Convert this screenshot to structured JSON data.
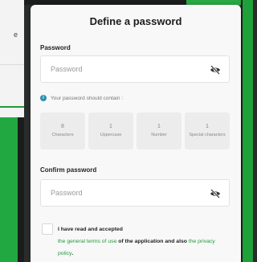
{
  "background": {
    "left_partial_text": "e"
  },
  "modal": {
    "title": "Define a password",
    "password": {
      "label": "Password",
      "placeholder": "Password"
    },
    "hint": "Your password should contain :",
    "requirements": [
      {
        "count": "8",
        "label": "Characters"
      },
      {
        "count": "1",
        "label": "Uppercase"
      },
      {
        "count": "1",
        "label": "Number"
      },
      {
        "count": "1",
        "label": "Special characters"
      }
    ],
    "confirm": {
      "label": "Confirm password",
      "placeholder": "Password"
    },
    "consent": {
      "text_1": "I have read and accepted",
      "link_terms": "the general terms of use",
      "text_2": "of the application and also",
      "link_privacy": "the privacy policy",
      "text_3": "."
    }
  },
  "colors": {
    "accent_green": "#1f9a3b",
    "info_blue": "#2b8fb3",
    "modal_bg": "#f7f8f7"
  },
  "icons": {
    "visibility_toggle": "eye-slash-icon",
    "info": "info-icon"
  }
}
